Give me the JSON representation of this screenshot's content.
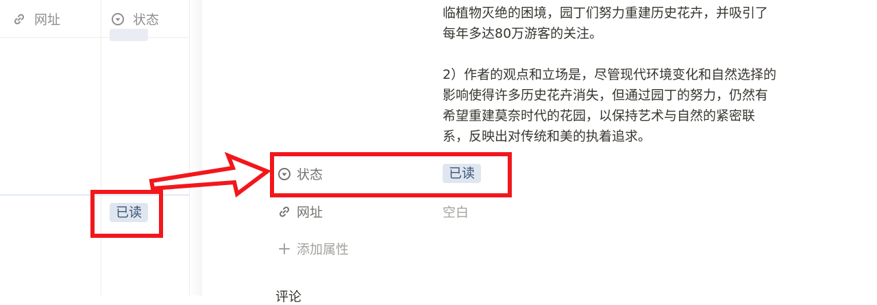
{
  "table": {
    "headers": [
      {
        "label": "网址",
        "icon": "link-icon"
      },
      {
        "label": "状态",
        "icon": "dropdown-circle-icon"
      }
    ],
    "row_status": "已读"
  },
  "detail": {
    "paragraph_1": [
      "临植物灭绝的困境，园丁们努力重建历史花卉，并吸引了",
      "每年多达80万游客的关注。"
    ],
    "paragraph_2": [
      "2）作者的观点和立场是，尽管现代环境变化和自然选择的",
      "影响使得许多历史花卉消失，但通过园丁的努力，仍然有",
      "希望重建莫奈时代的花园，以保持艺术与自然的紧密联",
      "系，反映出对传统和美的执着追求。"
    ],
    "properties": {
      "status": {
        "label": "状态",
        "value": "已读",
        "icon": "dropdown-circle-icon"
      },
      "url": {
        "label": "网址",
        "value": "空白",
        "icon": "link-icon"
      },
      "add_property": {
        "label": "添加属性",
        "icon": "plus-icon"
      }
    },
    "comments_label": "评论"
  },
  "colors": {
    "annotation_red": "#f2171c",
    "tag_bg": "#dfe6ef",
    "tag_text": "#3b5478",
    "muted_text": "#8f8e8b"
  }
}
